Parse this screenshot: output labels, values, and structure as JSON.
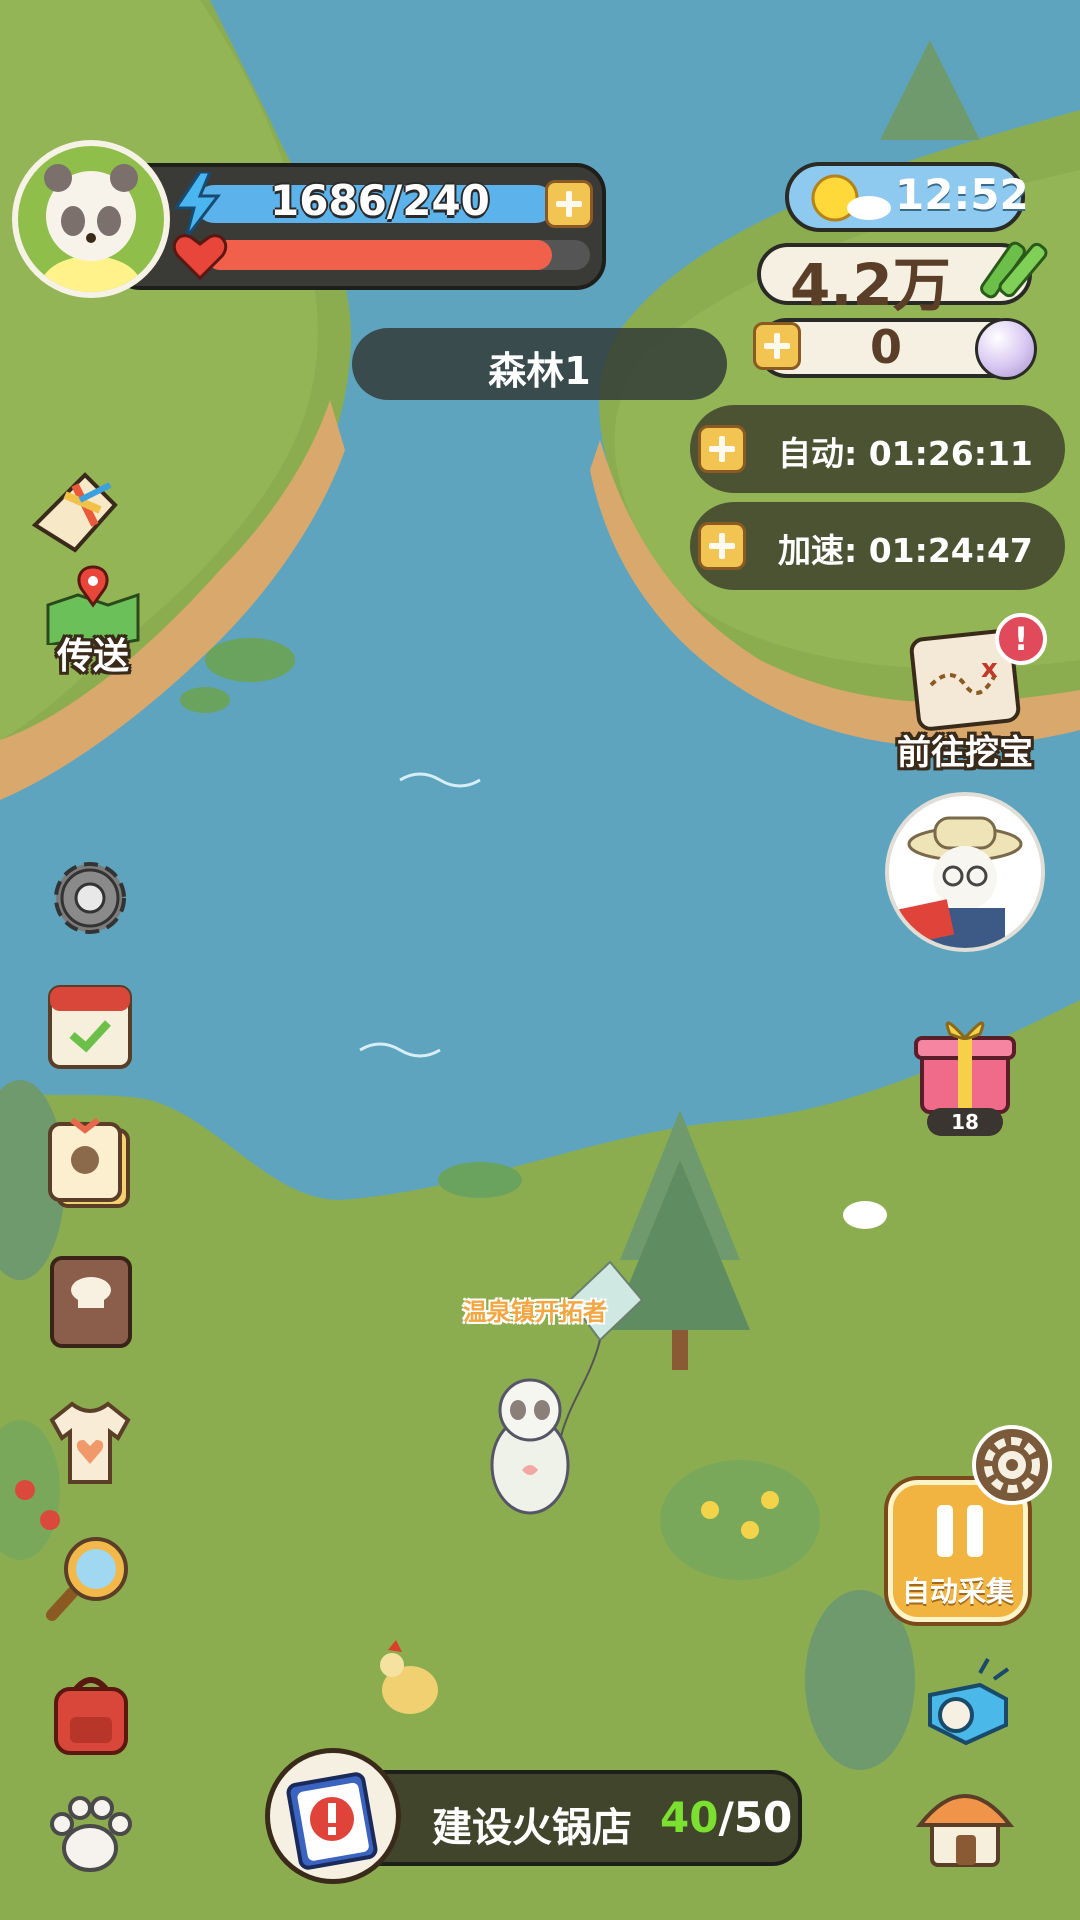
{
  "player": {
    "avatar_icon": "panda-avatar-icon",
    "energy_text": "1686/240",
    "energy_icon": "lightning-icon",
    "health_icon": "heart-icon",
    "health_fill": 0.9
  },
  "weather": {
    "icon": "sun-cloud-icon",
    "time": "12:52"
  },
  "currency": {
    "bamboo_amount": "4.2万",
    "bamboo_icon": "bamboo-icon",
    "pearl_amount": "0",
    "pearl_icon": "pearl-icon"
  },
  "location": {
    "name": "森林1"
  },
  "timers": {
    "auto_label": "自动:",
    "auto_value": "01:26:11",
    "speed_label": "加速:",
    "speed_value": "01:24:47"
  },
  "left_menu": {
    "kite_icon": "kite-icon",
    "teleport_label": "传送",
    "teleport_icon": "map-pin-icon",
    "settings_icon": "gear-icon",
    "calendar_icon": "calendar-icon",
    "tag_icon": "tag-icon",
    "cookbook_icon": "chef-book-icon",
    "shirt_icon": "shirt-icon",
    "search_icon": "magnifier-icon",
    "backpack_icon": "backpack-icon",
    "paw_icon": "paw-icon"
  },
  "right_menu": {
    "treasure_label": "前往挖宝",
    "treasure_icon": "treasure-map-icon",
    "treasure_alert": "!",
    "npc_icon": "explorer-panda-icon",
    "gift_icon": "gift-box-icon",
    "gift_count": "18",
    "auto_collect_label": "自动采集",
    "auto_collect_icon": "pause-icon",
    "auto_settings_icon": "gear-icon",
    "whistle_icon": "whistle-icon",
    "house_icon": "house-icon"
  },
  "character": {
    "title": "温泉镇开拓者"
  },
  "quest": {
    "icon": "clipboard-alert-icon",
    "title": "建设火锅店",
    "progress_current": "40",
    "progress_total": "/50",
    "current_color": "#7be030"
  },
  "colors": {
    "water": "#5ea4bf",
    "grass": "#8cad4f",
    "energy_bar": "#5cb2ea",
    "health_bar": "#f0604a",
    "button_gold": "#f2c451"
  }
}
